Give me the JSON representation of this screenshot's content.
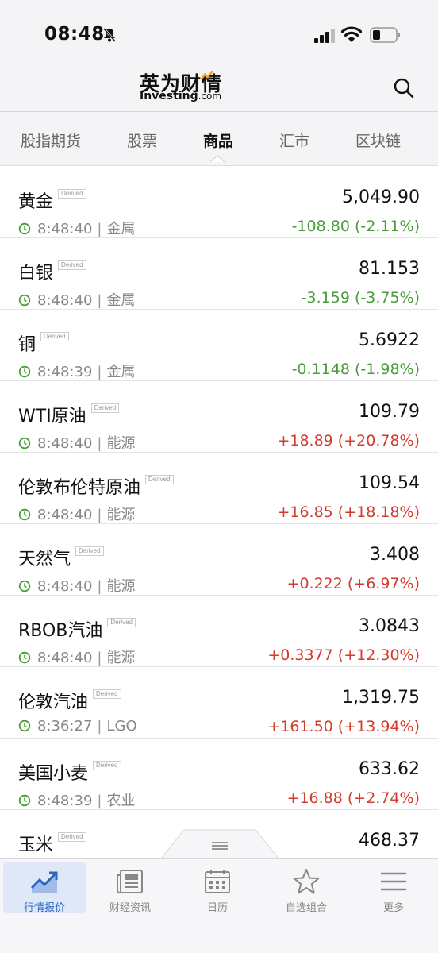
{
  "status_bar": {
    "time": "08:48"
  },
  "header": {
    "logo_cn": "英为财情",
    "logo_en": "Investing",
    "logo_domain": ".com"
  },
  "tabs": [
    {
      "label": "股指期货",
      "active": false
    },
    {
      "label": "股票",
      "active": false
    },
    {
      "label": "商品",
      "active": true
    },
    {
      "label": "汇市",
      "active": false
    },
    {
      "label": "区块链",
      "active": false
    }
  ],
  "derived_tag": "Derived",
  "rows": [
    {
      "name": "黄金",
      "price": "5,049.90",
      "time": "8:48:40",
      "category": "金属",
      "change": "-108.80 (-2.11%)",
      "direction": "down"
    },
    {
      "name": "白银",
      "price": "81.153",
      "time": "8:48:40",
      "category": "金属",
      "change": "-3.159 (-3.75%)",
      "direction": "down"
    },
    {
      "name": "铜",
      "price": "5.6922",
      "time": "8:48:39",
      "category": "金属",
      "change": "-0.1148 (-1.98%)",
      "direction": "down"
    },
    {
      "name": "WTI原油",
      "price": "109.79",
      "time": "8:48:40",
      "category": "能源",
      "change": "+18.89 (+20.78%)",
      "direction": "up"
    },
    {
      "name": "伦敦布伦特原油",
      "price": "109.54",
      "time": "8:48:40",
      "category": "能源",
      "change": "+16.85 (+18.18%)",
      "direction": "up"
    },
    {
      "name": "天然气",
      "price": "3.408",
      "time": "8:48:40",
      "category": "能源",
      "change": "+0.222 (+6.97%)",
      "direction": "up"
    },
    {
      "name": "RBOB汽油",
      "price": "3.0843",
      "time": "8:48:40",
      "category": "能源",
      "change": "+0.3377 (+12.30%)",
      "direction": "up"
    },
    {
      "name": "伦敦汽油",
      "price": "1,319.75",
      "time": "8:36:27",
      "category": "LGO",
      "change": "+161.50 (+13.94%)",
      "direction": "up"
    },
    {
      "name": "美国小麦",
      "price": "633.62",
      "time": "8:48:39",
      "category": "农业",
      "change": "+16.88 (+2.74%)",
      "direction": "up"
    },
    {
      "name": "玉米",
      "price": "468.37",
      "time": "",
      "category": "",
      "change": "",
      "direction": "up"
    }
  ],
  "bottom_nav": [
    {
      "label": "行情报价",
      "icon": "chart-line-icon",
      "active": true
    },
    {
      "label": "财经资讯",
      "icon": "newspaper-icon",
      "active": false
    },
    {
      "label": "日历",
      "icon": "calendar-icon",
      "active": false
    },
    {
      "label": "自选组合",
      "icon": "star-icon",
      "active": false
    },
    {
      "label": "更多",
      "icon": "menu-icon",
      "active": false
    }
  ],
  "colors": {
    "down": "#4a9b3a",
    "up": "#d33b2c",
    "accent": "#2b67c6",
    "logo_accent": "#f5a623"
  }
}
